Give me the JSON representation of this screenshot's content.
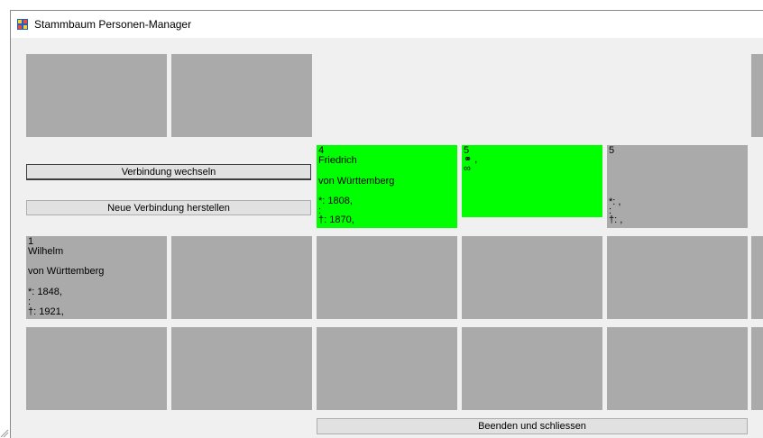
{
  "window": {
    "title": "Stammbaum Personen-Manager"
  },
  "buttons": {
    "switch_connection": "Verbindung wechseln",
    "new_connection": "Neue Verbindung herstellen",
    "exit": "Beenden und schliessen"
  },
  "cards": {
    "wilhelm": {
      "id": "1",
      "first_name": "Wilhelm",
      "last_name": "von Württemberg",
      "born": "*: 1848,",
      "mid": ":",
      "died": "†: 1921,"
    },
    "friedrich": {
      "id": "4",
      "first_name": "Friedrich",
      "last_name": "von Württemberg",
      "born": "*: 1808,",
      "mid": ":",
      "died": "†: 1870,"
    },
    "marriage": {
      "id": "5",
      "line1": "⚭ ,",
      "line2": "∞"
    },
    "empty": {
      "id": "5",
      "born": "*: ,",
      "mid": ":",
      "died": "†: ,"
    }
  },
  "colors": {
    "cell_gray": "#aaaaaa",
    "cell_green": "#00ff00",
    "form_bg": "#f0f0f0"
  }
}
